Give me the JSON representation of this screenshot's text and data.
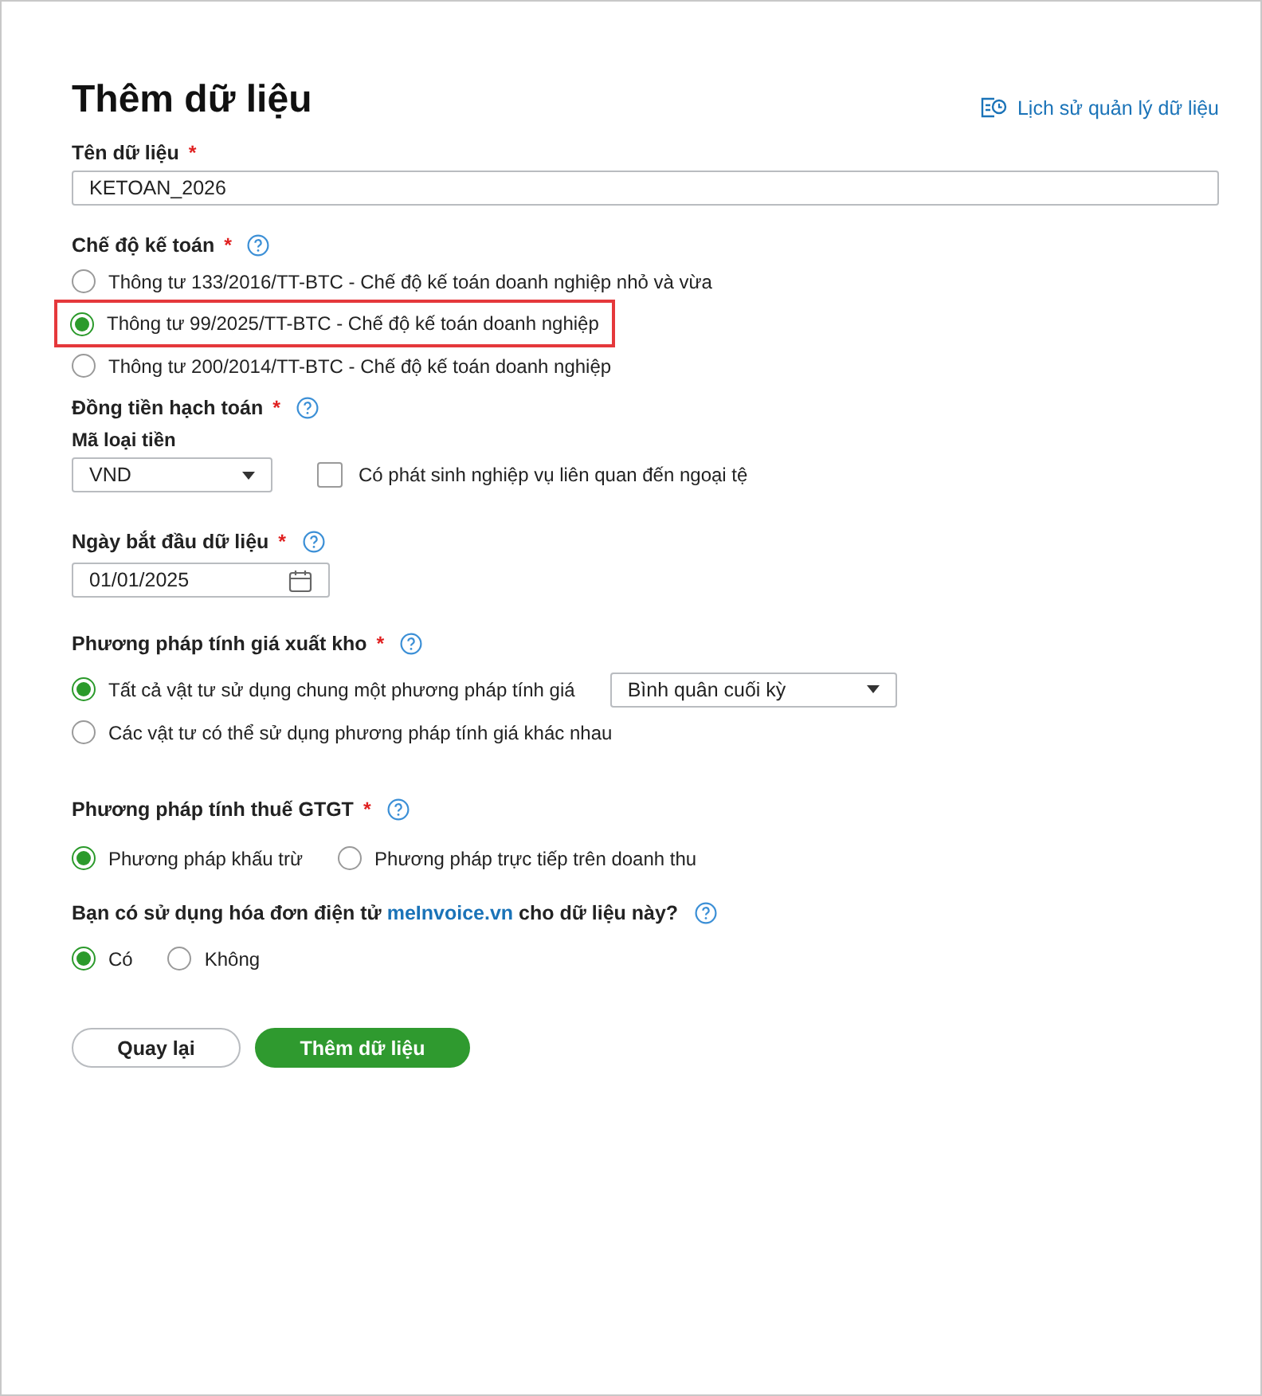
{
  "header": {
    "title": "Thêm dữ liệu",
    "history_link": "Lịch sử quản lý dữ liệu"
  },
  "data_name": {
    "label": "Tên dữ liệu",
    "required_mark": "*",
    "value": "KETOAN_2026"
  },
  "accounting_regime": {
    "label": "Chế độ kế toán",
    "required_mark": "*",
    "help": true,
    "options": [
      {
        "label": "Thông tư 133/2016/TT-BTC - Chế độ kế toán doanh nghiệp nhỏ và vừa",
        "selected": false,
        "highlighted": false
      },
      {
        "label": "Thông tư 99/2025/TT-BTC - Chế độ kế toán doanh nghiệp",
        "selected": true,
        "highlighted": true
      },
      {
        "label": "Thông tư 200/2014/TT-BTC - Chế độ kế toán doanh nghiệp",
        "selected": false,
        "highlighted": false
      }
    ]
  },
  "currency": {
    "label": "Đồng tiền hạch toán",
    "required_mark": "*",
    "help": true,
    "code_label": "Mã loại tiền",
    "code_value": "VND",
    "foreign_currency": {
      "label": "Có phát sinh nghiệp vụ liên quan đến ngoại tệ",
      "checked": false
    }
  },
  "start_date": {
    "label": "Ngày bắt đầu dữ liệu",
    "required_mark": "*",
    "help": true,
    "value": "01/01/2025"
  },
  "inventory_costing": {
    "label": "Phương pháp tính giá xuất kho",
    "required_mark": "*",
    "help": true,
    "options": [
      {
        "label": "Tất cả vật tư sử dụng chung một phương pháp tính giá",
        "selected": true,
        "method": "Bình quân cuối kỳ"
      },
      {
        "label": "Các vật tư có thể sử dụng phương pháp tính giá khác nhau",
        "selected": false
      }
    ]
  },
  "vat_method": {
    "label": "Phương pháp tính thuế GTGT",
    "required_mark": "*",
    "help": true,
    "options": [
      {
        "label": "Phương pháp khấu trừ",
        "selected": true
      },
      {
        "label": "Phương pháp trực tiếp trên doanh thu",
        "selected": false
      }
    ]
  },
  "einvoice": {
    "label_before": "Bạn có sử dụng hóa đơn điện tử",
    "link": "meInvoice.vn",
    "label_after": "cho dữ liệu này?",
    "help": true,
    "options": [
      {
        "label": "Có",
        "selected": true
      },
      {
        "label": "Không",
        "selected": false
      }
    ]
  },
  "buttons": [
    {
      "label": "Quay lại",
      "kind": "secondary"
    },
    {
      "label": "Thêm dữ liệu",
      "kind": "primary"
    }
  ]
}
